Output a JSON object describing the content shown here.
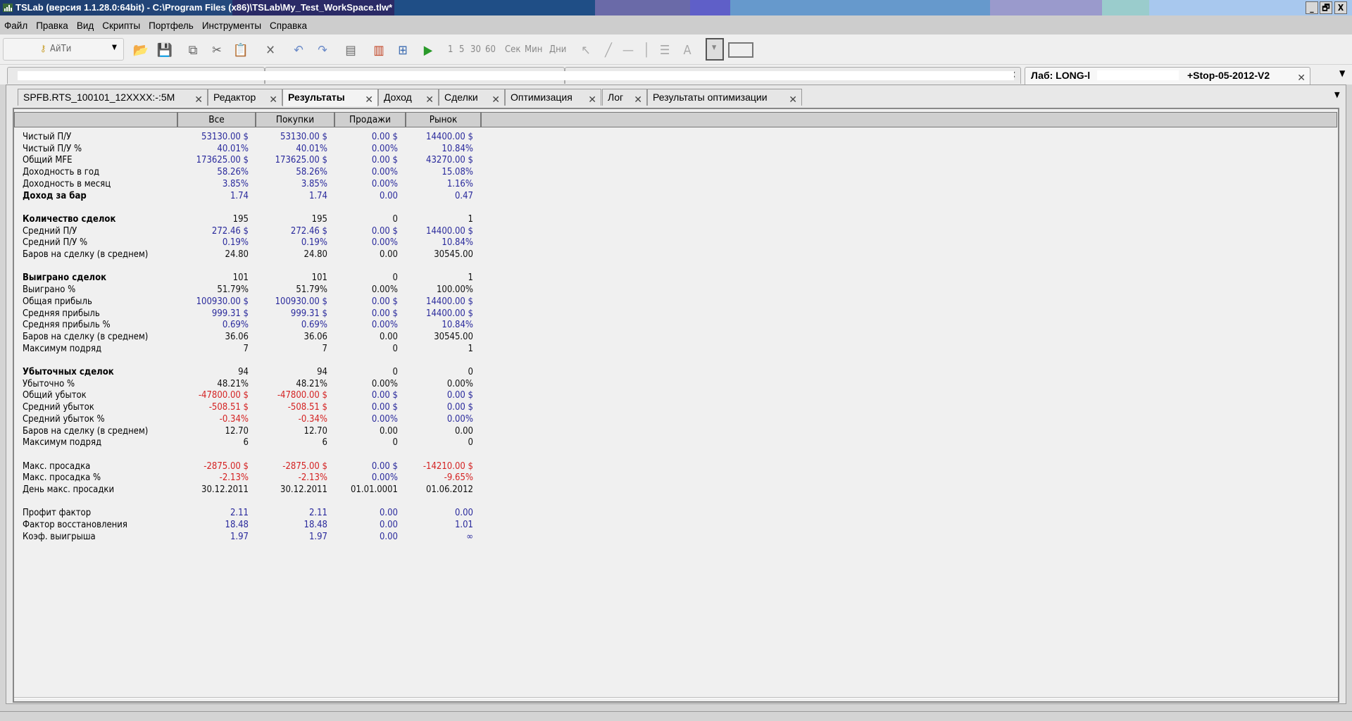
{
  "window": {
    "title": "TSLab (версия 1.1.28.0:64bit) - C:\\Program Files (x86)\\TSLab\\My_Test_WorkSpace.tlw*",
    "minimize": "_",
    "restore": "🗗",
    "close": "X"
  },
  "menu": [
    "Файл",
    "Правка",
    "Вид",
    "Скрипты",
    "Портфель",
    "Инструменты",
    "Справка"
  ],
  "toolbar": {
    "account": "АйТи",
    "intervals": [
      "1",
      "5",
      "30",
      "60"
    ],
    "units": [
      "Сек",
      "Мин",
      "Дни"
    ]
  },
  "doc_tabs": {
    "active_prefix": "Лаб: LONG-l",
    "active_suffix": "+Stop-05-2012-V2"
  },
  "inner_tabs": [
    {
      "label": "SPFB.RTS_100101_12XXXX:-:5M"
    },
    {
      "label": "Редактор"
    },
    {
      "label": "Результаты",
      "active": true
    },
    {
      "label": "Доход"
    },
    {
      "label": "Сделки"
    },
    {
      "label": "Оптимизация"
    },
    {
      "label": "Лог"
    },
    {
      "label": "Результаты оптимизации"
    }
  ],
  "colors": {
    "blue": "#2a2a9c",
    "red": "#d42222",
    "black": "#111"
  },
  "results": {
    "columns": [
      "Все",
      "Покупки",
      "Продажи",
      "Рынок"
    ],
    "rows": [
      {
        "label": "Чистый П/У",
        "c": "bbbb",
        "v": [
          "53130.00 $",
          "53130.00 $",
          "0.00 $",
          "14400.00 $"
        ]
      },
      {
        "label": "Чистый П/У %",
        "c": "bbbb",
        "v": [
          "40.01%",
          "40.01%",
          "0.00%",
          "10.84%"
        ]
      },
      {
        "label": "Общий MFE",
        "c": "bbbb",
        "v": [
          "173625.00 $",
          "173625.00 $",
          "0.00 $",
          "43270.00 $"
        ]
      },
      {
        "label": "Доходность в год",
        "c": "bbbb",
        "v": [
          "58.26%",
          "58.26%",
          "0.00%",
          "15.08%"
        ]
      },
      {
        "label": "Доходность в месяц",
        "c": "bbbb",
        "v": [
          "3.85%",
          "3.85%",
          "0.00%",
          "1.16%"
        ]
      },
      {
        "label": "Доход за бар",
        "bold": true,
        "c": "bbbb",
        "v": [
          "1.74",
          "1.74",
          "0.00",
          "0.47"
        ]
      },
      null,
      {
        "label": "Количество сделок",
        "bold": true,
        "c": "kkkk",
        "v": [
          "195",
          "195",
          "0",
          "1"
        ]
      },
      {
        "label": "Средний П/У",
        "c": "bbbb",
        "v": [
          "272.46 $",
          "272.46 $",
          "0.00 $",
          "14400.00 $"
        ]
      },
      {
        "label": "Средний П/У %",
        "c": "bbbb",
        "v": [
          "0.19%",
          "0.19%",
          "0.00%",
          "10.84%"
        ]
      },
      {
        "label": "Баров на сделку (в среднем)",
        "c": "kkkk",
        "v": [
          "24.80",
          "24.80",
          "0.00",
          "30545.00"
        ]
      },
      null,
      {
        "label": "Выиграно сделок",
        "bold": true,
        "c": "kkkk",
        "v": [
          "101",
          "101",
          "0",
          "1"
        ]
      },
      {
        "label": "Выиграно %",
        "c": "kkkk",
        "v": [
          "51.79%",
          "51.79%",
          "0.00%",
          "100.00%"
        ]
      },
      {
        "label": "Общая прибыль",
        "c": "bbbb",
        "v": [
          "100930.00 $",
          "100930.00 $",
          "0.00 $",
          "14400.00 $"
        ]
      },
      {
        "label": "Средняя прибыль",
        "c": "bbbb",
        "v": [
          "999.31 $",
          "999.31 $",
          "0.00 $",
          "14400.00 $"
        ]
      },
      {
        "label": "Средняя прибыль %",
        "c": "bbbb",
        "v": [
          "0.69%",
          "0.69%",
          "0.00%",
          "10.84%"
        ]
      },
      {
        "label": "Баров на сделку (в среднем)",
        "c": "kkkk",
        "v": [
          "36.06",
          "36.06",
          "0.00",
          "30545.00"
        ]
      },
      {
        "label": "Максимум подряд",
        "c": "kkkk",
        "v": [
          "7",
          "7",
          "0",
          "1"
        ]
      },
      null,
      {
        "label": "Убыточных сделок",
        "bold": true,
        "c": "kkkk",
        "v": [
          "94",
          "94",
          "0",
          "0"
        ]
      },
      {
        "label": "Убыточно %",
        "c": "kkkk",
        "v": [
          "48.21%",
          "48.21%",
          "0.00%",
          "0.00%"
        ]
      },
      {
        "label": "Общий убыток",
        "c": "rrbb",
        "v": [
          "-47800.00 $",
          "-47800.00 $",
          "0.00 $",
          "0.00 $"
        ]
      },
      {
        "label": "Средний убыток",
        "c": "rrbb",
        "v": [
          "-508.51 $",
          "-508.51 $",
          "0.00 $",
          "0.00 $"
        ]
      },
      {
        "label": "Средний убыток %",
        "c": "rrbb",
        "v": [
          "-0.34%",
          "-0.34%",
          "0.00%",
          "0.00%"
        ]
      },
      {
        "label": "Баров на сделку (в среднем)",
        "c": "kkkk",
        "v": [
          "12.70",
          "12.70",
          "0.00",
          "0.00"
        ]
      },
      {
        "label": "Максимум подряд",
        "c": "kkkk",
        "v": [
          "6",
          "6",
          "0",
          "0"
        ]
      },
      null,
      {
        "label": "Макс. просадка",
        "c": "rrbr",
        "v": [
          "-2875.00 $",
          "-2875.00 $",
          "0.00 $",
          "-14210.00 $"
        ]
      },
      {
        "label": "Макс. просадка %",
        "c": "rrbr",
        "v": [
          "-2.13%",
          "-2.13%",
          "0.00%",
          "-9.65%"
        ]
      },
      {
        "label": "День макс. просадки",
        "c": "kkkk",
        "v": [
          "30.12.2011",
          "30.12.2011",
          "01.01.0001",
          "01.06.2012"
        ]
      },
      null,
      {
        "label": "Профит фактор",
        "c": "bbbb",
        "v": [
          "2.11",
          "2.11",
          "0.00",
          "0.00"
        ]
      },
      {
        "label": "Фактор восстановления",
        "c": "bbbb",
        "v": [
          "18.48",
          "18.48",
          "0.00",
          "1.01"
        ]
      },
      {
        "label": "Коэф. выигрыша",
        "c": "bbbb",
        "v": [
          "1.97",
          "1.97",
          "0.00",
          "∞"
        ]
      }
    ]
  }
}
